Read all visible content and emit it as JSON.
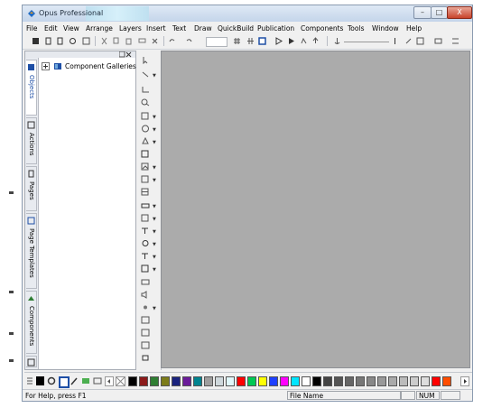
{
  "window": {
    "title": "Opus Professional",
    "controls": {
      "minimize": "–",
      "maximize": "□",
      "close": "X"
    }
  },
  "menubar": {
    "items": [
      "File",
      "Edit",
      "View",
      "Arrange",
      "Layers",
      "Insert",
      "Text",
      "Draw",
      "QuickBuild",
      "Publication",
      "Components",
      "Tools",
      "Window",
      "Help"
    ]
  },
  "objects_panel": {
    "tabs": [
      "Objects",
      "Actions",
      "Pages",
      "Page Templates",
      "Components"
    ],
    "tree": {
      "root_label": "Component Galleries"
    }
  },
  "palette": {
    "colors": [
      "#000000",
      "#8b1a1a",
      "#2e7d32",
      "#7c7c1a",
      "#1a237e",
      "#6a1b9a",
      "#00838f",
      "#9e9e9e",
      "#cfd8dc",
      "#e0f7fa",
      "#ff0000",
      "#00c853",
      "#ffff00",
      "#1e40ff",
      "#ff00ff",
      "#00e5ff",
      "#ffffff",
      "#000000",
      "#444444",
      "#555555",
      "#666666",
      "#777777",
      "#888888",
      "#999999",
      "#aaaaaa",
      "#bbbbbb",
      "#cccccc",
      "#dddddd",
      "#ff0000",
      "#ff4d00"
    ]
  },
  "statusbar": {
    "help_text": "For Help, press F1",
    "file_name": "File Name",
    "num_indicator": "NUM"
  }
}
